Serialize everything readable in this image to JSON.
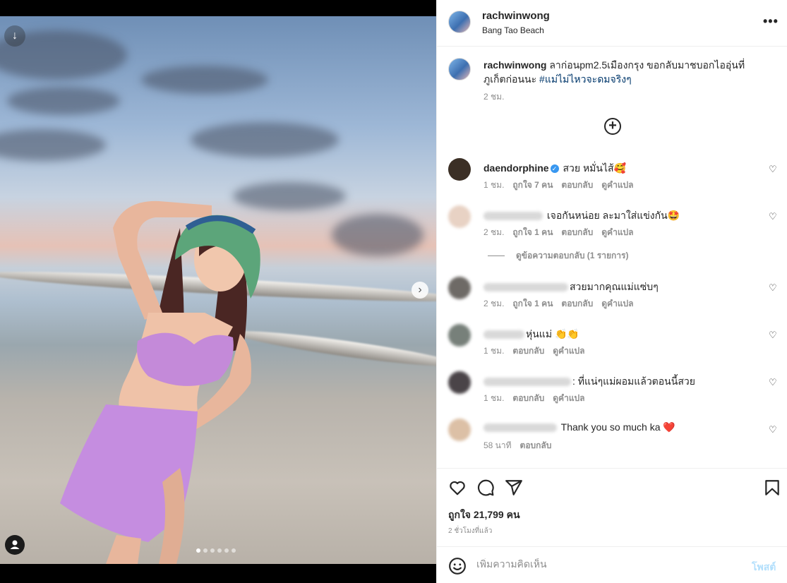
{
  "post": {
    "username": "rachwinwong",
    "location": "Bang Tao Beach",
    "caption_text": "ลาก่อนpm2.5เมืองกรุง ขอกลับมาชบอกไออุ่นที่ภูเก็ตก่อนนะ",
    "caption_tag": "#แม่ไม่ไหวจะดมจริงๆ",
    "caption_time": "2 ชม.",
    "likes": "ถูกใจ 21,799 คน",
    "posted_ago": "2 ชั่วโมงที่แล้ว",
    "carousel_count": 6,
    "carousel_active_index": 0
  },
  "icons": {
    "more": "more-horizontal-icon",
    "download": "download-icon",
    "next": "chevron-right-icon",
    "tag": "user-tag-icon",
    "add": "plus-circle-icon",
    "like": "heart-icon",
    "comment": "comment-icon",
    "share": "send-icon",
    "save": "bookmark-icon",
    "emoji": "emoji-icon"
  },
  "colors": {
    "hashtag": "#00376b",
    "verified": "#3897f0",
    "post_disabled": "#b2dffc",
    "heart_emoji": "#ed4956"
  },
  "comments": [
    {
      "username": "daendorphine",
      "verified": true,
      "text": "สวย หมั่นไส้🥰",
      "time": "1 ชม.",
      "likes": "ถูกใจ 7 คน",
      "reply": "ตอบกลับ",
      "translate": "ดูคำแปล"
    },
    {
      "username": "",
      "text": "เจอกันหน่อย ละมาใส่แข่งกัน🤩",
      "time": "2 ชม.",
      "likes": "ถูกใจ 1 คน",
      "reply": "ตอบกลับ",
      "translate": "ดูคำแปล"
    },
    {
      "username": "",
      "text": "สวยมากคุณแม่แซ่บๆ",
      "time": "2 ชม.",
      "likes": "ถูกใจ 1 คน",
      "reply": "ตอบกลับ",
      "translate": "ดูคำแปล"
    },
    {
      "username": "",
      "text": "หุ่นแม่ 👏👏",
      "time": "1 ชม.",
      "reply": "ตอบกลับ",
      "translate": "ดูคำแปล"
    },
    {
      "username": "",
      "text": ": ที่แน่ๆแม่ผอมแล้วตอนนี้สวย",
      "time": "1 ชม.",
      "reply": "ตอบกลับ",
      "translate": "ดูคำแปล"
    },
    {
      "username": "",
      "text": "Thank you so much ka ❤️",
      "time": "58 นาที",
      "reply": "ตอบกลับ"
    }
  ],
  "replies_toggle": "ดูข้อความตอบกลับ (1 รายการ)",
  "composer": {
    "placeholder": "เพิ่มความคิดเห็น",
    "post_label": "โพสต์"
  }
}
